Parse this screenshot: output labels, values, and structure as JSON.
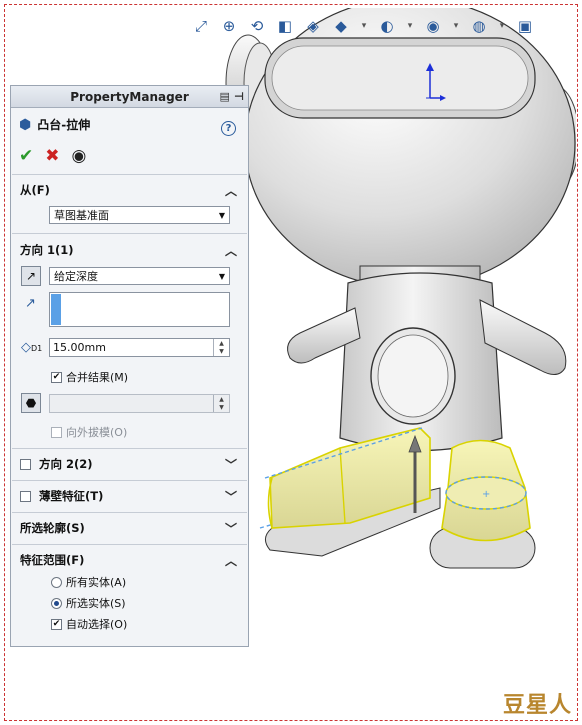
{
  "toolbar": {
    "icons": [
      "zoom-fit-icon",
      "zoom-area-icon",
      "previous-view-icon",
      "section-view-icon",
      "view-orientation-icon",
      "display-style-icon",
      "hide-show-icon",
      "appearance-icon",
      "scene-icon",
      "view-settings-icon"
    ]
  },
  "property_manager": {
    "header": "PropertyManager",
    "feature_title": "凸台-拉伸",
    "help": "?",
    "ok": "✔",
    "cancel": "✖",
    "preview": "👁",
    "from": {
      "label": "从(F)",
      "value": "草图基准面"
    },
    "direction1": {
      "label": "方向 1(1)",
      "end_condition": "给定深度",
      "depth": "15.00mm",
      "depth_label": "D1",
      "merge_result": "合并结果(M)",
      "merge_checked": true,
      "draft_label": "向外拔模(O)",
      "draft_checked": false
    },
    "direction2": {
      "label": "方向 2(2)",
      "checked": false
    },
    "thin_feature": {
      "label": "薄壁特征(T)",
      "checked": false
    },
    "selected_contours": {
      "label": "所选轮廓(S)"
    },
    "feature_scope": {
      "label": "特征范围(F)",
      "all_bodies": "所有实体(A)",
      "selected_bodies": "所选实体(S)",
      "auto_select": "自动选择(O)",
      "selected_option": "selected_bodies",
      "auto_select_checked": true
    }
  },
  "watermark": "豆星人",
  "colors": {
    "model": "#dcdcdc",
    "highlight": "#f2ef8a",
    "selection": "#5aa0e6",
    "triad_blue": "#1c2fd8"
  }
}
